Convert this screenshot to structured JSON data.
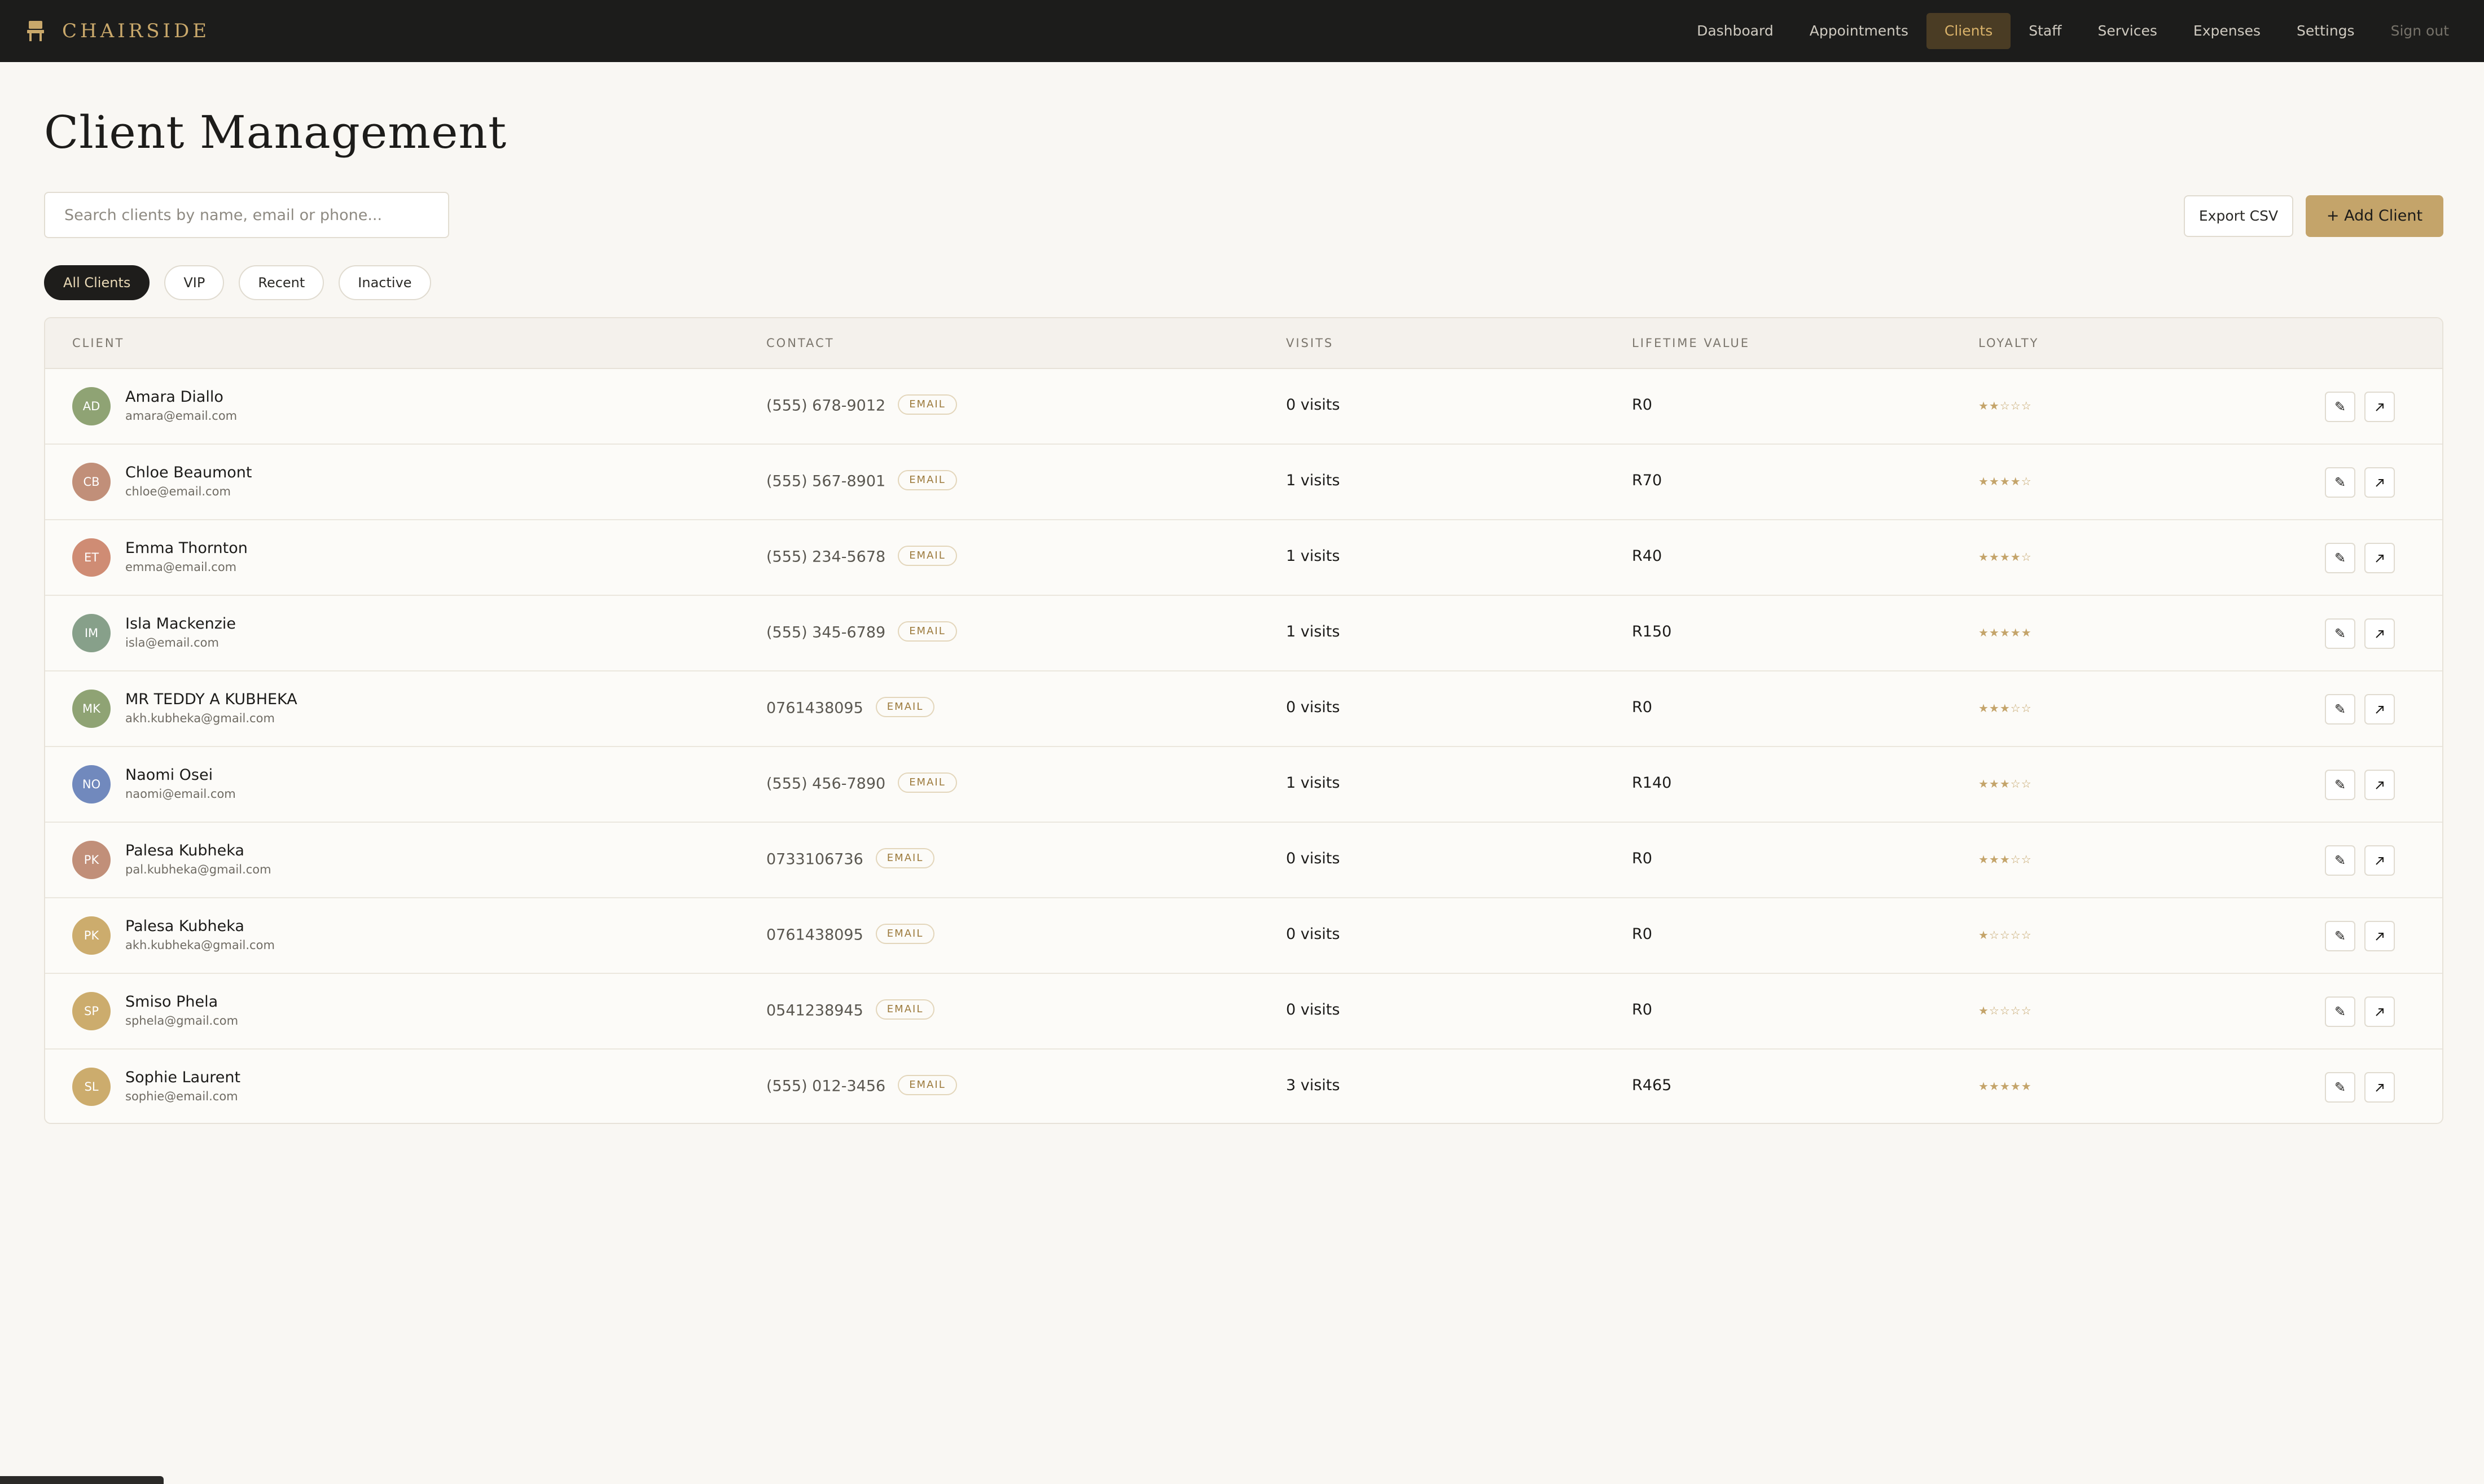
{
  "brand": {
    "name": "CHAIRSIDE"
  },
  "nav": [
    {
      "label": "Dashboard",
      "active": false
    },
    {
      "label": "Appointments",
      "active": false
    },
    {
      "label": "Clients",
      "active": true
    },
    {
      "label": "Staff",
      "active": false
    },
    {
      "label": "Services",
      "active": false
    },
    {
      "label": "Expenses",
      "active": false
    },
    {
      "label": "Settings",
      "active": false
    },
    {
      "label": "Sign out",
      "active": false
    }
  ],
  "page": {
    "title": "Client Management"
  },
  "search": {
    "placeholder": "Search clients by name, email or phone..."
  },
  "actions": {
    "export_label": "Export CSV",
    "add_label": "+ Add Client"
  },
  "filters": [
    {
      "label": "All Clients",
      "active": true
    },
    {
      "label": "VIP",
      "active": false
    },
    {
      "label": "Recent",
      "active": false
    },
    {
      "label": "Inactive",
      "active": false
    }
  ],
  "table": {
    "headers": {
      "client": "CLIENT",
      "contact": "CONTACT",
      "visits": "VISITS",
      "value": "LIFETIME VALUE",
      "loyalty": "LOYALTY"
    },
    "tag_label": "EMAIL",
    "rows": [
      {
        "initials": "AD",
        "avatar_color": "#8fa374",
        "name": "Amara Diallo",
        "email": "amara@email.com",
        "phone": "(555) 678-9012",
        "visits": "0 visits",
        "value": "R0",
        "stars": "★★☆☆☆"
      },
      {
        "initials": "CB",
        "avatar_color": "#c18f79",
        "name": "Chloe Beaumont",
        "email": "chloe@email.com",
        "phone": "(555) 567-8901",
        "visits": "1 visits",
        "value": "R70",
        "stars": "★★★★☆"
      },
      {
        "initials": "ET",
        "avatar_color": "#cf8c74",
        "name": "Emma Thornton",
        "email": "emma@email.com",
        "phone": "(555) 234-5678",
        "visits": "1 visits",
        "value": "R40",
        "stars": "★★★★☆"
      },
      {
        "initials": "IM",
        "avatar_color": "#87a08a",
        "name": "Isla Mackenzie",
        "email": "isla@email.com",
        "phone": "(555) 345-6789",
        "visits": "1 visits",
        "value": "R150",
        "stars": "★★★★★"
      },
      {
        "initials": "MK",
        "avatar_color": "#8fa374",
        "name": "MR TEDDY A KUBHEKA",
        "email": "akh.kubheka@gmail.com",
        "phone": "0761438095",
        "visits": "0 visits",
        "value": "R0",
        "stars": "★★★☆☆"
      },
      {
        "initials": "NO",
        "avatar_color": "#7189bd",
        "name": "Naomi Osei",
        "email": "naomi@email.com",
        "phone": "(555) 456-7890",
        "visits": "1 visits",
        "value": "R140",
        "stars": "★★★☆☆"
      },
      {
        "initials": "PK",
        "avatar_color": "#c18f79",
        "name": "Palesa Kubheka",
        "email": "pal.kubheka@gmail.com",
        "phone": "0733106736",
        "visits": "0 visits",
        "value": "R0",
        "stars": "★★★☆☆"
      },
      {
        "initials": "PK",
        "avatar_color": "#ccac6d",
        "name": "Palesa Kubheka",
        "email": "akh.kubheka@gmail.com",
        "phone": "0761438095",
        "visits": "0 visits",
        "value": "R0",
        "stars": "★☆☆☆☆"
      },
      {
        "initials": "SP",
        "avatar_color": "#ccac6d",
        "name": "Smiso Phela",
        "email": "sphela@gmail.com",
        "phone": "0541238945",
        "visits": "0 visits",
        "value": "R0",
        "stars": "★☆☆☆☆"
      },
      {
        "initials": "SL",
        "avatar_color": "#ccac6d",
        "name": "Sophie Laurent",
        "email": "sophie@email.com",
        "phone": "(555) 012-3456",
        "visits": "3 visits",
        "value": "R465",
        "stars": "★★★★★"
      }
    ]
  },
  "icons": {
    "edit": "pencil-icon",
    "open": "arrow-up-right-icon",
    "logo": "chair-icon"
  }
}
